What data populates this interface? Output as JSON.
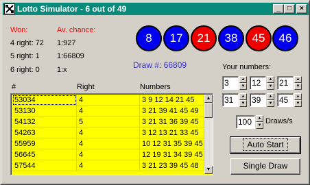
{
  "window": {
    "title": "Lotto Simulator - 6 out of 49"
  },
  "titlebar_buttons": {
    "minimize": "_",
    "maximize": "□",
    "close": "×"
  },
  "stats": {
    "won_header": "Won:",
    "chance_header": "Av. chance:",
    "rows": [
      {
        "label": "4 right: 72",
        "chance": "1:927"
      },
      {
        "label": "5 right: 1",
        "chance": "1:66809"
      },
      {
        "label": "6 right: 0",
        "chance": "1:x"
      }
    ]
  },
  "balls": [
    {
      "number": "8",
      "color": "#0000ee"
    },
    {
      "number": "17",
      "color": "#0000ee"
    },
    {
      "number": "21",
      "color": "#ee0000"
    },
    {
      "number": "38",
      "color": "#0000ee"
    },
    {
      "number": "45",
      "color": "#ee0000"
    },
    {
      "number": "46",
      "color": "#0000ee"
    }
  ],
  "draw_label": "Draw #: 66809",
  "table": {
    "headers": [
      "#",
      "Right",
      "Numbers"
    ],
    "rows": [
      [
        "53034",
        "4",
        "3 9 12 14 21 45"
      ],
      [
        "53130",
        "4",
        "3 21 39 41 45 49"
      ],
      [
        "54132",
        "5",
        "3 21 31 36 39 45"
      ],
      [
        "54263",
        "4",
        "3 12 13 21 33 45"
      ],
      [
        "55959",
        "4",
        "10 12 31 35 39 45"
      ],
      [
        "56645",
        "4",
        "12 19 31 34 39 45"
      ],
      [
        "57544",
        "4",
        "3 21 23 39 45 48"
      ]
    ]
  },
  "your_numbers": {
    "label": "Your numbers:",
    "values": [
      "3",
      "12",
      "21",
      "31",
      "39",
      "45"
    ]
  },
  "draws": {
    "value": "100",
    "label": "Draws/s"
  },
  "buttons": {
    "auto_start": "Auto Start",
    "single_draw": "Single Draw"
  },
  "colors": {
    "titlebar": "#0a8a7a",
    "table_bg": "#ffff00",
    "highlight_red": "#ff0000",
    "draw_label_blue": "#3333cc"
  }
}
